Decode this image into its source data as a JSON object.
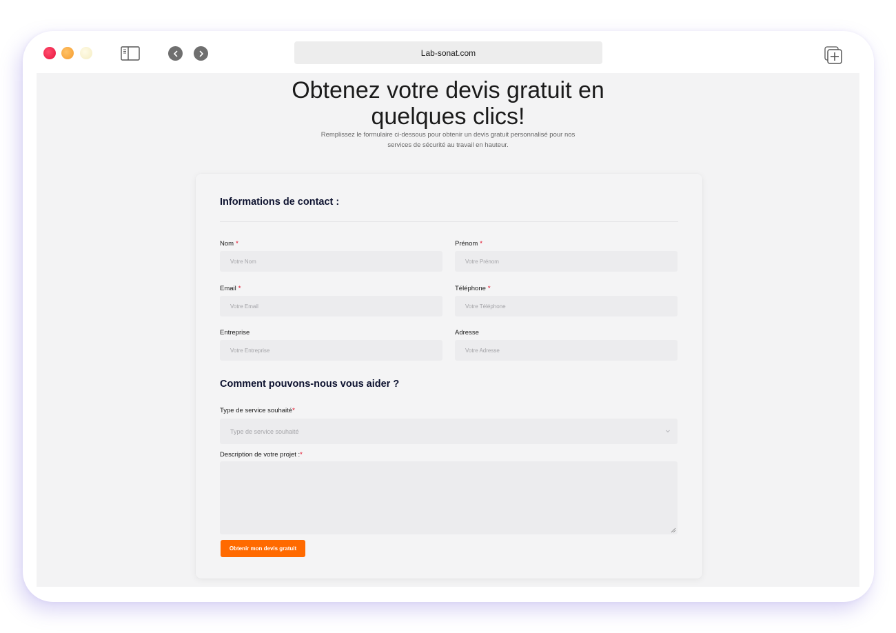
{
  "browser": {
    "url": "Lab-sonat.com",
    "icons": [
      "close-dot",
      "minimize-dot",
      "maximize-dot",
      "sidebar-icon",
      "back-icon",
      "forward-icon",
      "new-tab-icon"
    ]
  },
  "hero": {
    "title_line1": "Obtenez votre devis gratuit en",
    "title_line2": "quelques clics!",
    "subtitle_line1": "Remplissez le formulaire ci-dessous pour obtenir un devis gratuit personnalisé pour nos",
    "subtitle_line2": "services de sécurité au travail en hauteur."
  },
  "form": {
    "contact_title": "Informations de contact :",
    "fields": {
      "nom": {
        "label": "Nom",
        "required": "*",
        "placeholder": "Votre Nom"
      },
      "prenom": {
        "label": "Prénom",
        "required": "*",
        "placeholder": "Votre Prénom"
      },
      "email": {
        "label": "Email",
        "required": "*",
        "placeholder": "Votre Email"
      },
      "telephone": {
        "label": "Téléphone",
        "required": "*",
        "placeholder": "Votre Téléphone"
      },
      "entreprise": {
        "label": "Entreprise",
        "placeholder": "Votre Entreprise"
      },
      "adresse": {
        "label": "Adresse",
        "placeholder": "Votre Adresse"
      }
    },
    "help_title": "Comment pouvons-nous vous aider ?",
    "service": {
      "label": "Type de service souhaité",
      "required": "*",
      "selected": "Type de service souhaité"
    },
    "description": {
      "label": "Description de votre projet :",
      "required": "*"
    },
    "submit_label": "Obtenir mon devis gratuit",
    "colors": {
      "accent": "#ff6a00",
      "required": "#e0001a",
      "heading": "#0e1330"
    }
  }
}
